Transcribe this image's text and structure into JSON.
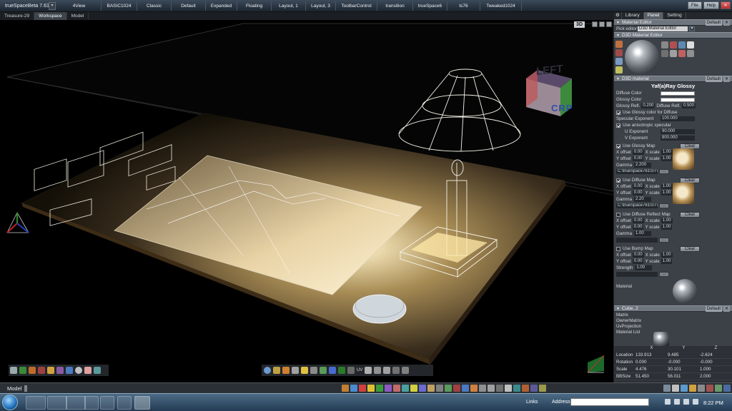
{
  "titlebar": {
    "app_title": "trueSpaceBeta 7.61",
    "tabs": [
      "4View",
      "BASIC1024",
      "Classic",
      "Default",
      "Expanded",
      "Floating",
      "Layout, 1",
      "Layout, 3",
      "ToolbarControl",
      "transition",
      "trueSpace6",
      "ts76",
      "Tweaked1024"
    ],
    "file_label": "File",
    "help_label": "Help"
  },
  "subtabs": [
    "Treasure-29",
    "Workspace",
    "Model"
  ],
  "viewport": {
    "mode_badge": "3D",
    "cube_label": "LEFT",
    "crp_label": "CRP",
    "toolbar_right_label": "UV"
  },
  "panel": {
    "tabs": [
      "Library",
      "Panel",
      "Setting"
    ],
    "material_editor": {
      "title": "Material Editor",
      "pick_editor_label": "Pick editor",
      "pick_editor_value": "D3D Material Editor",
      "default_label": "Default"
    },
    "d3d_editor": {
      "title": "D3D Material Editor"
    },
    "d3d_material": {
      "title": "D3D material",
      "default_label": "Default",
      "material_name": "Yaf(a)Ray Glossy",
      "diffuse_color": "Diffuse Color",
      "glossy_color": "Glossy Color",
      "glossy_refl": "Glossy Refl.",
      "glossy_refl_val": "0.200",
      "diffuse_refl": "Diffuse Refl.",
      "diffuse_refl_val": "0.500",
      "use_glossy_color": "Use Glossy color for Diffuse",
      "specular_exp": "Specular Exponent",
      "specular_exp_val": "100.000",
      "use_anisotropic": "Use anisotropic specular",
      "u_exp": "U Exponent",
      "u_exp_val": "90.000",
      "v_exp": "V Exponent",
      "v_exp_val": "800.000",
      "maps": [
        {
          "label": "Use Glossy Map",
          "checked": true,
          "xoff": "0.00",
          "xscale": "1.00",
          "yoff": "0.00",
          "yscale": "1.00",
          "last_label": "Gamma",
          "last_val": "2.200",
          "path": "C:\\trueSpace761\\ST\\Tex",
          "has_thumb": true
        },
        {
          "label": "Use Diffuse Map",
          "checked": true,
          "xoff": "0.00",
          "xscale": "1.00",
          "yoff": "0.00",
          "yscale": "1.00",
          "last_label": "Gamma",
          "last_val": "2.20",
          "path": "C:\\trueSpace761\\ST\\Tex",
          "has_thumb": true
        },
        {
          "label": "Use Diffuse Reflect Map",
          "checked": false,
          "xoff": "0.00",
          "xscale": "1.00",
          "yoff": "0.00",
          "yscale": "1.00",
          "last_label": "Gamma",
          "last_val": "1.00",
          "path": "",
          "has_thumb": false
        },
        {
          "label": "Use Bump Map",
          "checked": false,
          "xoff": "0.00",
          "xscale": "1.00",
          "yoff": "0.00",
          "yscale": "1.00",
          "last_label": "Strength",
          "last_val": "1.00",
          "path": "",
          "has_thumb": false
        }
      ],
      "clear_label": "Clear",
      "xoffset_label": "X offset",
      "xscale_label": "X scale",
      "yoffset_label": "Y offset",
      "yscale_label": "Y scale",
      "material_label": "Material"
    },
    "cube": {
      "title": "Cube, 2",
      "default_label": "Default",
      "items": [
        "Matrix",
        "OwnerMatrix",
        "UvProjection",
        "Material List"
      ]
    },
    "transform": {
      "headers": [
        "",
        "X",
        "Y",
        "Z"
      ],
      "rows": [
        {
          "label": "Location",
          "x": "133.913",
          "y": "9.485",
          "z": "-2.624"
        },
        {
          "label": "Rotation",
          "x": "0.000",
          "y": "-0.000",
          "z": "-0.000"
        },
        {
          "label": "Scale",
          "x": "4.476",
          "y": "30.101",
          "z": "1.000"
        },
        {
          "label": "BBSize",
          "x": "51.450",
          "y": "56.011",
          "z": "2.000"
        }
      ]
    }
  },
  "statusbar": {
    "model_label": "Model"
  },
  "taskbar": {
    "links_label": "Links",
    "address_label": "Address",
    "clock": "8:22 PM"
  },
  "colors": {
    "accent": "#3c4a5a",
    "panel_bg": "#3c4148",
    "section_header": "#6e757d",
    "crp": "#2f4fa8"
  }
}
